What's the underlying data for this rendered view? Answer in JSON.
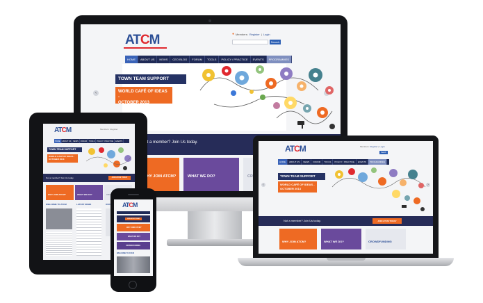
{
  "brand": {
    "logo": "ATCM"
  },
  "header": {
    "members_label": "Members:",
    "register_link": "Register",
    "separator": "|",
    "login_link": "Login",
    "search_button": "Search"
  },
  "nav": {
    "items": [
      "HOME",
      "ABOUT US",
      "NEWS",
      "CEO BLOG",
      "FORUM",
      "TOOLS",
      "POLICY / PRACTICE",
      "EVENTS",
      "PROGRAMMES"
    ],
    "active": "HOME",
    "compact_items": [
      "HOME",
      "ABOUT US",
      "NEWS",
      "FORUM",
      "TOOLS",
      "POLICY / PRACTICE",
      "EVENTS",
      "PROGRAMMES"
    ]
  },
  "banner": {
    "title": "TOWN TEAM SUPPORT",
    "event": "WORLD CAFÉ OF IDEAS - OCTOBER 2013",
    "event_line1": "WORLD CAFÉ OF IDEAS -",
    "event_line2": "OCTOBER 2013"
  },
  "member": {
    "prompt": "Not a member? Join Us today.",
    "button": "JOIN ATCM TODAY"
  },
  "tiles": {
    "join": "WHY JOIN ATCM?",
    "what": "WHAT WE DO?",
    "crowd": "CROWDFUNDING"
  },
  "tablet": {
    "welcome": "WELCOME TO ATCM",
    "latest": "LATEST NEWS",
    "partners": "OUR PARTNERS"
  },
  "phone": {
    "welcome": "WELCOME TO ATCM"
  },
  "colors": {
    "navy": "#1f2a56",
    "orange": "#ee6a23",
    "purple": "#6a4a9c",
    "logo_blue": "#2c4f96",
    "logo_red": "#e0292f"
  }
}
